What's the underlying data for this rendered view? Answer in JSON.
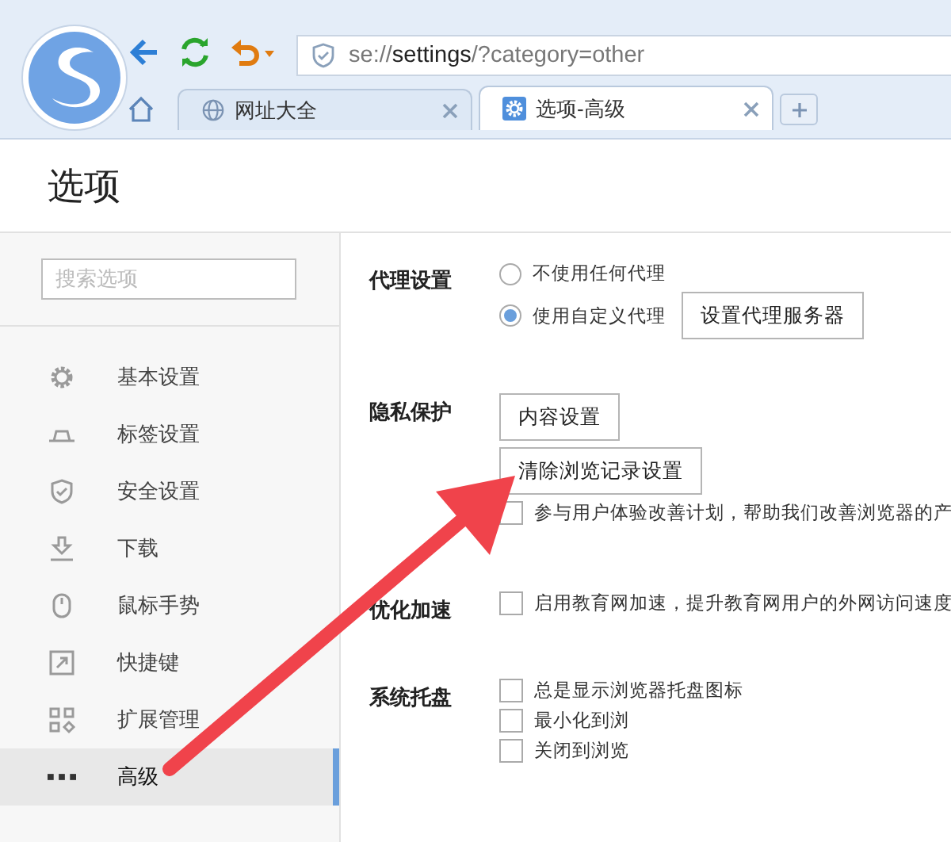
{
  "toolbar": {
    "address": {
      "scheme": "se://",
      "host": "settings",
      "path": "/?category=other"
    }
  },
  "tabs": [
    {
      "title": "网址大全",
      "selected": false
    },
    {
      "title": "选项-高级",
      "selected": true
    }
  ],
  "page_title": "选项",
  "sidebar": {
    "search": {
      "placeholder": "搜索选项"
    },
    "items": [
      {
        "label": "基本设置",
        "selected": false
      },
      {
        "label": "标签设置",
        "selected": false
      },
      {
        "label": "安全设置",
        "selected": false
      },
      {
        "label": "下载",
        "selected": false
      },
      {
        "label": "鼠标手势",
        "selected": false
      },
      {
        "label": "快捷键",
        "selected": false
      },
      {
        "label": "扩展管理",
        "selected": false
      },
      {
        "label": "高级",
        "selected": true
      }
    ]
  },
  "sections": [
    {
      "label": "代理设置",
      "rows": [
        [
          {
            "kind": "radio",
            "label": "不使用任何代理",
            "selected": false
          }
        ],
        [
          {
            "kind": "radio",
            "label": "使用自定义代理",
            "selected": true
          },
          {
            "kind": "button",
            "label": "设置代理服务器"
          }
        ]
      ]
    },
    {
      "label": "隐私保护",
      "rows": [
        [
          {
            "kind": "button",
            "label": "内容设置"
          }
        ],
        [
          {
            "kind": "button",
            "label": "清除浏览记录设置"
          }
        ],
        [
          {
            "kind": "checkbox",
            "label": "参与用户体验改善计划，帮助我们改善浏览器的产",
            "checked": false
          }
        ]
      ]
    },
    {
      "label": "优化加速",
      "rows": [
        [
          {
            "kind": "checkbox",
            "label": "启用教育网加速，提升教育网用户的外网访问速度",
            "checked": false
          }
        ]
      ]
    },
    {
      "label": "系统托盘",
      "rows": [
        [
          {
            "kind": "checkbox",
            "label": "总是显示浏览器托盘图标",
            "checked": false
          }
        ],
        [
          {
            "kind": "checkbox",
            "label": "最小化到浏",
            "checked": false
          }
        ],
        [
          {
            "kind": "checkbox",
            "label": "关闭到浏览",
            "checked": false
          }
        ]
      ]
    }
  ]
}
